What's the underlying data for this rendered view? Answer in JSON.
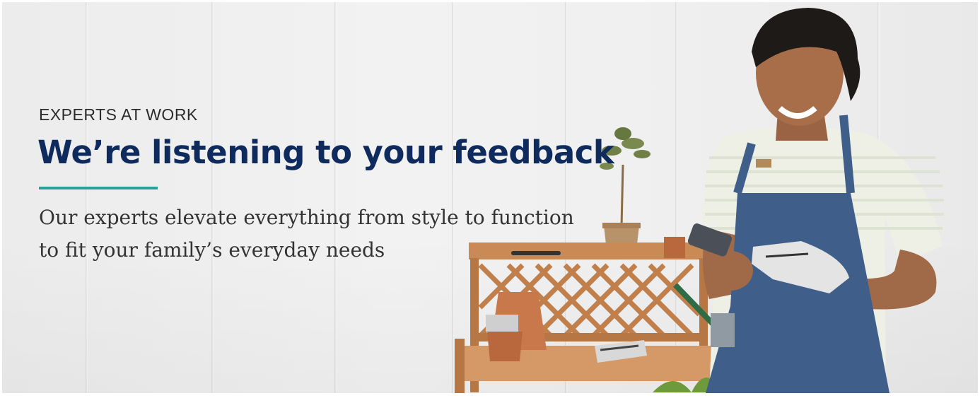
{
  "hero": {
    "eyebrow": "EXPERTS AT WORK",
    "headline": "We’re listening to your feedback",
    "subhead": "Our experts elevate everything from style to function to fit your family’s everyday needs"
  },
  "colors": {
    "headline": "#0f2a5c",
    "accent_rule": "#2aa198",
    "apron": "#3f5f8a",
    "wood": "#c98a55"
  },
  "icons": [
    "potted-tree-icon",
    "potting-bench-icon",
    "gardener-with-phone-icon"
  ]
}
